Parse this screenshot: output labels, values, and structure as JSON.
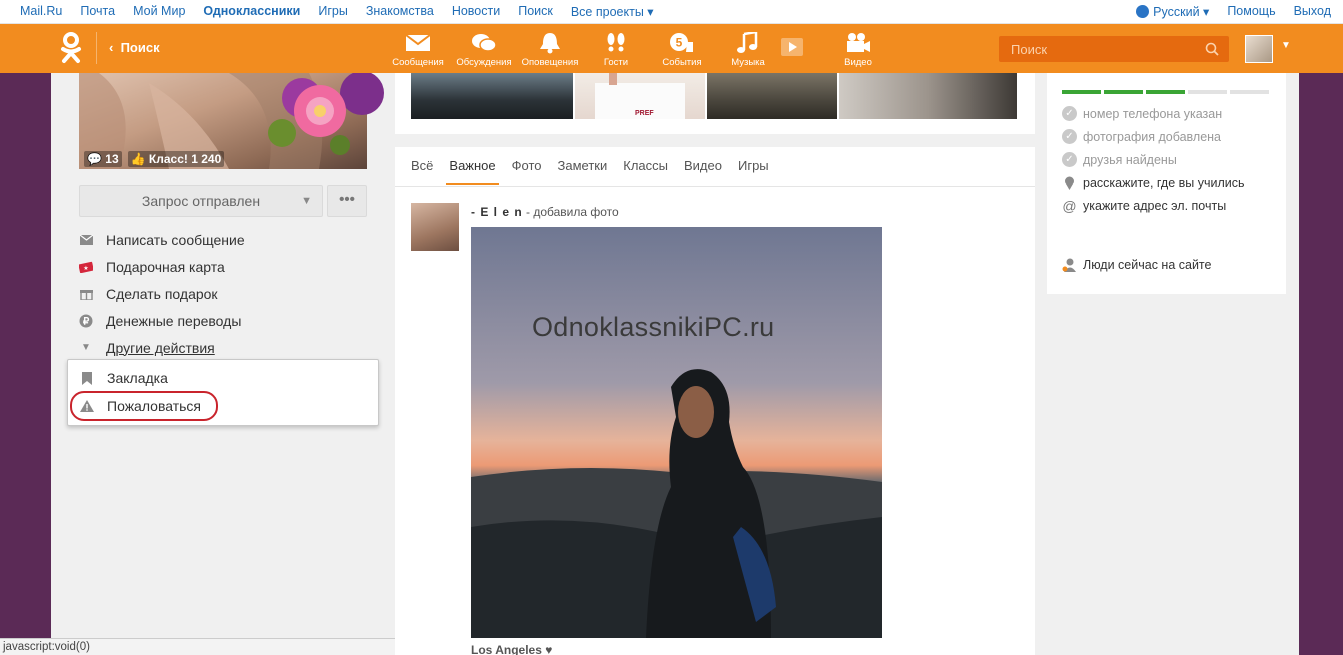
{
  "topbar": {
    "links": [
      "Mail.Ru",
      "Почта",
      "Мой Мир",
      "Одноклассники",
      "Игры",
      "Знакомства",
      "Новости",
      "Поиск",
      "Все проекты ▾"
    ],
    "active_link": "Одноклассники",
    "language": "Русский ▾",
    "help": "Помощь",
    "logout": "Выход"
  },
  "header": {
    "back_label": "Поиск",
    "nav": [
      {
        "label": "Сообщения",
        "icon": "envelope-icon"
      },
      {
        "label": "Обсуждения",
        "icon": "chat-bubbles-icon"
      },
      {
        "label": "Оповещения",
        "icon": "bell-icon"
      },
      {
        "label": "Гости",
        "icon": "footprints-icon"
      },
      {
        "label": "События",
        "icon": "events-icon"
      },
      {
        "label": "Музыка",
        "icon": "music-icon"
      },
      {
        "label": "Видео",
        "icon": "video-camera-icon"
      }
    ],
    "events_count": "5",
    "search_placeholder": "Поиск",
    "brand_color": "#f28c1f"
  },
  "profile": {
    "comments_count": "13",
    "class_label": "Класс! 1 240",
    "request_button": "Запрос отправлен",
    "more_button": "•••",
    "actions": [
      {
        "label": "Написать сообщение",
        "icon": "envelope-icon"
      },
      {
        "label": "Подарочная карта",
        "icon": "gift-card-icon"
      },
      {
        "label": "Сделать подарок",
        "icon": "gift-icon"
      },
      {
        "label": "Денежные переводы",
        "icon": "ruble-icon"
      },
      {
        "label": "Другие действия",
        "icon": "triangle-down-icon"
      }
    ],
    "dropdown": [
      {
        "label": "Закладка",
        "icon": "bookmark-icon"
      },
      {
        "label": "Пожаловаться",
        "icon": "warning-icon"
      }
    ]
  },
  "feed": {
    "tabs": [
      "Всё",
      "Важное",
      "Фото",
      "Заметки",
      "Классы",
      "Видео",
      "Игры"
    ],
    "active_tab": "Важное",
    "post": {
      "author": "- E l e n",
      "action": " - добавила фото",
      "watermark": "OdnoklassnikiPC.ru",
      "caption": "Los Angeles ♥"
    }
  },
  "sidebar": {
    "progress_done": 3,
    "progress_total": 5,
    "checklist": [
      {
        "label": "номер телефона указан",
        "done": true
      },
      {
        "label": "фотография добавлена",
        "done": true
      },
      {
        "label": "друзья найдены",
        "done": true
      },
      {
        "label": "расскажите, где вы учились",
        "done": false,
        "icon": "pin-icon"
      },
      {
        "label": "укажите адрес эл. почты",
        "done": false,
        "icon": "at-icon"
      }
    ],
    "people_online": "Люди сейчас на сайте"
  },
  "statusbar": "javascript:void(0)"
}
